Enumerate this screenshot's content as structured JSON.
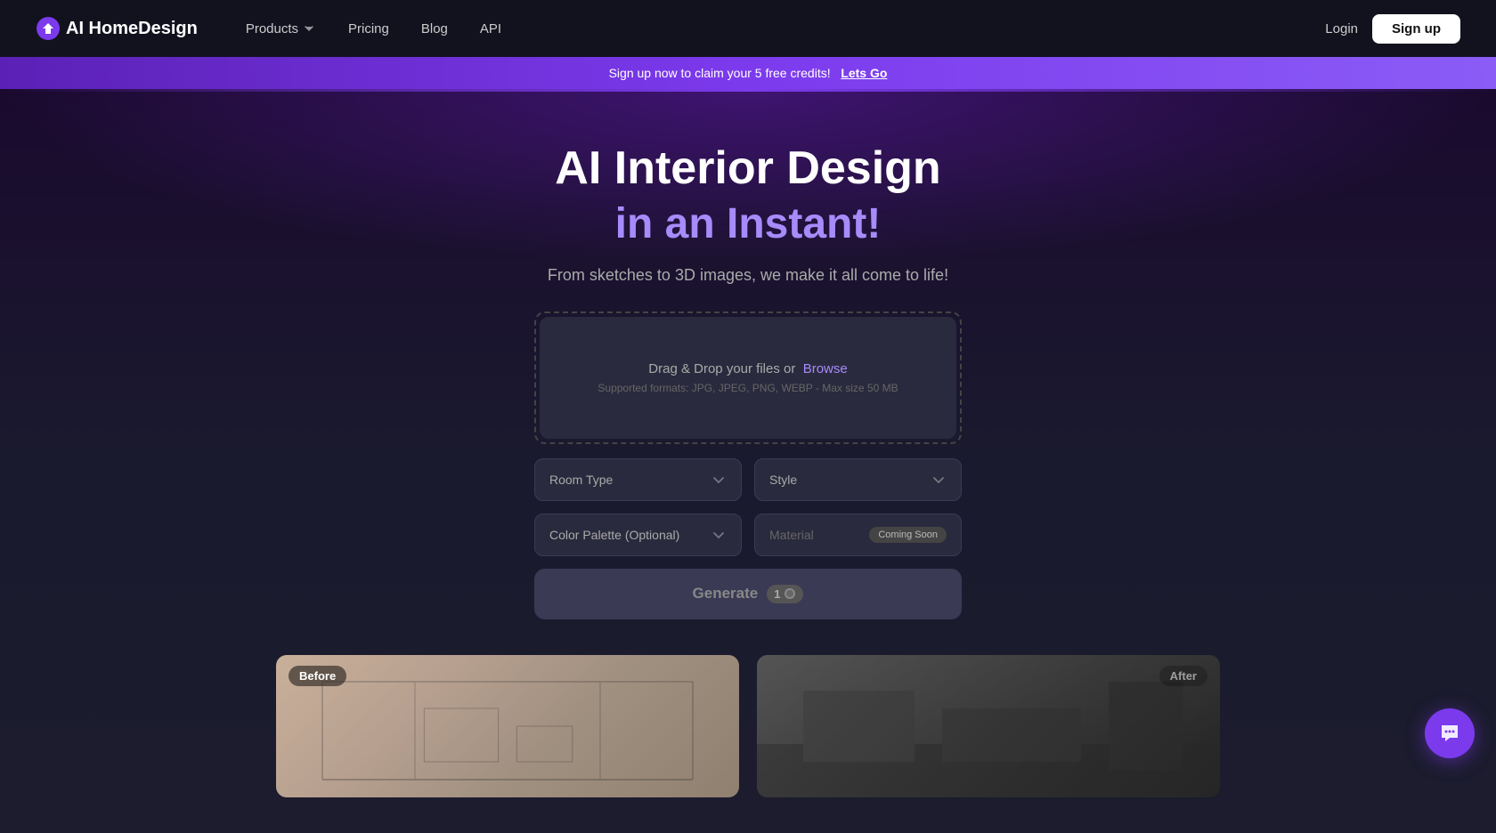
{
  "navbar": {
    "logo_text": "AI HomeDesign",
    "nav_items": [
      {
        "label": "Products",
        "has_chevron": true
      },
      {
        "label": "Pricing",
        "has_chevron": false
      },
      {
        "label": "Blog",
        "has_chevron": false
      },
      {
        "label": "API",
        "has_chevron": false
      }
    ],
    "login_label": "Login",
    "signup_label": "Sign up"
  },
  "banner": {
    "text": "Sign up now to claim your 5 free credits!",
    "cta": "Lets Go"
  },
  "hero": {
    "title": "AI Interior Design",
    "subtitle": "in an Instant!",
    "description": "From sketches to 3D images, we make it all come to life!"
  },
  "upload": {
    "main_text": "Drag & Drop your files or",
    "browse_label": "Browse",
    "formats_text": "Supported formats: JPG, JPEG, PNG, WEBP - Max size 50 MB"
  },
  "controls": {
    "room_type_label": "Room Type",
    "style_label": "Style",
    "color_palette_label": "Color Palette (Optional)",
    "material_label": "Material",
    "coming_soon_label": "Coming Soon"
  },
  "generate": {
    "label": "Generate",
    "credits": "1",
    "credit_icon": "coin"
  },
  "before_after": {
    "before_label": "Before",
    "after_label": "After"
  },
  "chat": {
    "icon": "chat-bubble"
  }
}
